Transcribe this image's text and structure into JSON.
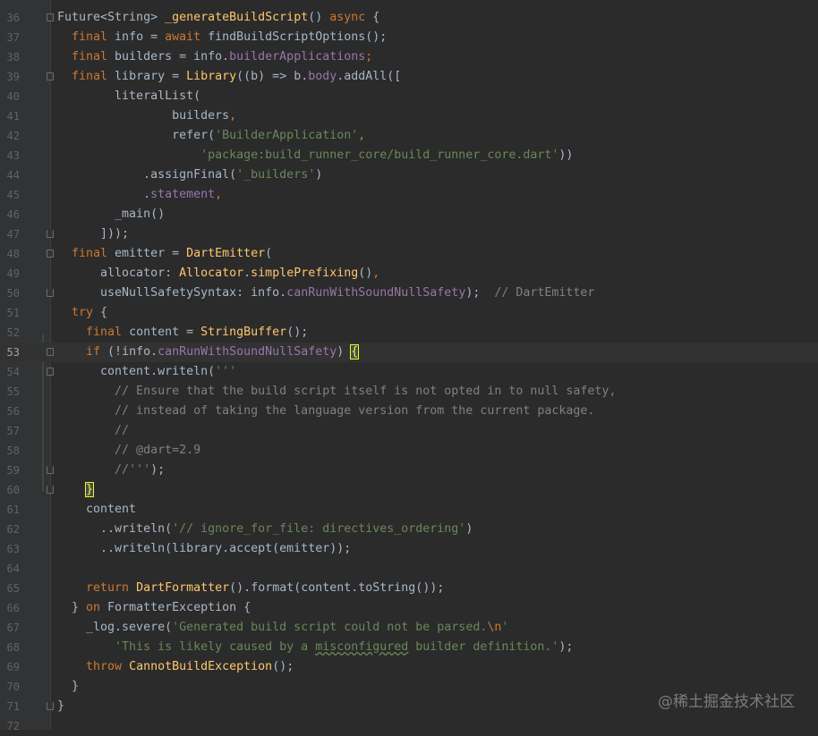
{
  "editor": {
    "current_line": 53,
    "lines": [
      {
        "n": "36",
        "tokens": [
          [
            "",
            "Future<String> "
          ],
          [
            "fn",
            "_generateBuildScript"
          ],
          [
            "",
            "() "
          ],
          [
            "kw",
            "async"
          ],
          [
            "",
            " {"
          ]
        ]
      },
      {
        "n": "37",
        "tokens": [
          [
            "",
            "  "
          ],
          [
            "kw",
            "final"
          ],
          [
            "",
            " info = "
          ],
          [
            "kw",
            "await"
          ],
          [
            "",
            " findBuildScriptOptions();"
          ]
        ]
      },
      {
        "n": "38",
        "tokens": [
          [
            "",
            "  "
          ],
          [
            "kw",
            "final"
          ],
          [
            "",
            " builders = info."
          ],
          [
            "fld",
            "builderApplications"
          ],
          [
            "kw",
            ";"
          ]
        ]
      },
      {
        "n": "39",
        "tokens": [
          [
            "",
            "  "
          ],
          [
            "kw",
            "final"
          ],
          [
            "",
            " library = "
          ],
          [
            "cls",
            "Library"
          ],
          [
            "",
            "((b) => b."
          ],
          [
            "fld",
            "body"
          ],
          [
            "",
            ".addAll(["
          ]
        ]
      },
      {
        "n": "40",
        "tokens": [
          [
            "",
            "        literalList("
          ]
        ]
      },
      {
        "n": "41",
        "tokens": [
          [
            "",
            "                builders"
          ],
          [
            "kw",
            ","
          ]
        ]
      },
      {
        "n": "42",
        "tokens": [
          [
            "",
            "                refer("
          ],
          [
            "str",
            "'BuilderApplication'"
          ],
          [
            "kw",
            ","
          ]
        ]
      },
      {
        "n": "43",
        "tokens": [
          [
            "",
            "                    "
          ],
          [
            "str",
            "'package:build_runner_core/build_runner_core.dart'"
          ],
          [
            "",
            "))"
          ]
        ]
      },
      {
        "n": "44",
        "tokens": [
          [
            "",
            "            .assignFinal("
          ],
          [
            "str",
            "'_builders'"
          ],
          [
            "",
            ")"
          ]
        ]
      },
      {
        "n": "45",
        "tokens": [
          [
            "",
            "            ."
          ],
          [
            "fld",
            "statement"
          ],
          [
            "kw",
            ","
          ]
        ]
      },
      {
        "n": "46",
        "tokens": [
          [
            "",
            "        _main()"
          ]
        ]
      },
      {
        "n": "47",
        "tokens": [
          [
            "",
            "      ]));"
          ]
        ]
      },
      {
        "n": "48",
        "tokens": [
          [
            "",
            "  "
          ],
          [
            "kw",
            "final"
          ],
          [
            "",
            " emitter = "
          ],
          [
            "cls",
            "DartEmitter"
          ],
          [
            "",
            "("
          ]
        ]
      },
      {
        "n": "49",
        "tokens": [
          [
            "",
            "      allocator: "
          ],
          [
            "cls",
            "Allocator"
          ],
          [
            "",
            "."
          ],
          [
            "fn",
            "simplePrefixing"
          ],
          [
            "",
            "()"
          ],
          [
            "kw",
            ","
          ]
        ]
      },
      {
        "n": "50",
        "tokens": [
          [
            "",
            "      useNullSafetySyntax: info."
          ],
          [
            "fld",
            "canRunWithSoundNullSafety"
          ],
          [
            "",
            ");  "
          ],
          [
            "cm",
            "// DartEmitter"
          ]
        ]
      },
      {
        "n": "51",
        "tokens": [
          [
            "",
            "  "
          ],
          [
            "kw",
            "try"
          ],
          [
            "",
            " {"
          ]
        ]
      },
      {
        "n": "52",
        "tokens": [
          [
            "",
            "    "
          ],
          [
            "kw",
            "final"
          ],
          [
            "",
            " content = "
          ],
          [
            "cls",
            "StringBuffer"
          ],
          [
            "",
            "();"
          ]
        ]
      },
      {
        "n": "53",
        "tokens": [
          [
            "",
            "    "
          ],
          [
            "kw",
            "if"
          ],
          [
            "",
            " (!info."
          ],
          [
            "fld",
            "canRunWithSoundNullSafety"
          ],
          [
            "",
            ") "
          ],
          [
            "brace-hl",
            "{"
          ]
        ]
      },
      {
        "n": "54",
        "tokens": [
          [
            "",
            "      content.writeln("
          ],
          [
            "str",
            "'''"
          ]
        ]
      },
      {
        "n": "55",
        "tokens": [
          [
            "cm",
            "        // Ensure that the build script itself is not opted in to null safety,"
          ]
        ]
      },
      {
        "n": "56",
        "tokens": [
          [
            "cm",
            "        // instead of taking the language version from the current package."
          ]
        ]
      },
      {
        "n": "57",
        "tokens": [
          [
            "cm",
            "        //"
          ]
        ]
      },
      {
        "n": "58",
        "tokens": [
          [
            "cm",
            "        // @dart=2.9"
          ]
        ]
      },
      {
        "n": "59",
        "tokens": [
          [
            "cm",
            "        //"
          ],
          [
            "str",
            "'''"
          ],
          [
            "",
            ");"
          ]
        ]
      },
      {
        "n": "60",
        "tokens": [
          [
            "",
            "    "
          ],
          [
            "brace-hl",
            "}"
          ]
        ]
      },
      {
        "n": "61",
        "tokens": [
          [
            "",
            "    content"
          ]
        ]
      },
      {
        "n": "62",
        "tokens": [
          [
            "",
            "      ..writeln("
          ],
          [
            "str",
            "'// ignore_for_file: directives_ordering'"
          ],
          [
            "",
            ")"
          ]
        ]
      },
      {
        "n": "63",
        "tokens": [
          [
            "",
            "      ..writeln(library.accept(emitter));"
          ]
        ]
      },
      {
        "n": "64",
        "tokens": [
          [
            "",
            ""
          ]
        ]
      },
      {
        "n": "65",
        "tokens": [
          [
            "",
            "    "
          ],
          [
            "kw",
            "return"
          ],
          [
            "",
            " "
          ],
          [
            "cls",
            "DartFormatter"
          ],
          [
            "",
            "().format(content.toString());"
          ]
        ]
      },
      {
        "n": "66",
        "tokens": [
          [
            "",
            "  } "
          ],
          [
            "kw",
            "on"
          ],
          [
            "",
            " FormatterException {"
          ]
        ]
      },
      {
        "n": "67",
        "tokens": [
          [
            "",
            "    _log.severe("
          ],
          [
            "str",
            "'Generated build script could not be parsed."
          ],
          [
            "esc",
            "\\n"
          ],
          [
            "str",
            "'"
          ]
        ]
      },
      {
        "n": "68",
        "tokens": [
          [
            "",
            "        "
          ],
          [
            "str",
            "'This is likely caused by a "
          ],
          [
            "str typo",
            "misconfigured"
          ],
          [
            "str",
            " builder definition.'"
          ],
          [
            "",
            ");"
          ]
        ]
      },
      {
        "n": "69",
        "tokens": [
          [
            "",
            "    "
          ],
          [
            "kw",
            "throw"
          ],
          [
            "",
            " "
          ],
          [
            "cls",
            "CannotBuildException"
          ],
          [
            "",
            "();"
          ]
        ]
      },
      {
        "n": "70",
        "tokens": [
          [
            "",
            "  }"
          ]
        ]
      },
      {
        "n": "71",
        "tokens": [
          [
            "",
            "}"
          ]
        ]
      },
      {
        "n": "72",
        "tokens": [
          [
            "",
            ""
          ]
        ]
      }
    ],
    "fold_markers": {
      "36": "start",
      "39": "start",
      "47": "end",
      "48": "start",
      "50": "end",
      "53": "start",
      "54": "start",
      "59": "end",
      "60": "end",
      "71": "end"
    }
  },
  "watermark": "@稀土掘金技术社区",
  "colors": {
    "background": "#2b2b2b",
    "keyword": "#cc7832",
    "function": "#ffc66d",
    "string": "#6a8759",
    "comment": "#808080",
    "field": "#9876aa"
  }
}
